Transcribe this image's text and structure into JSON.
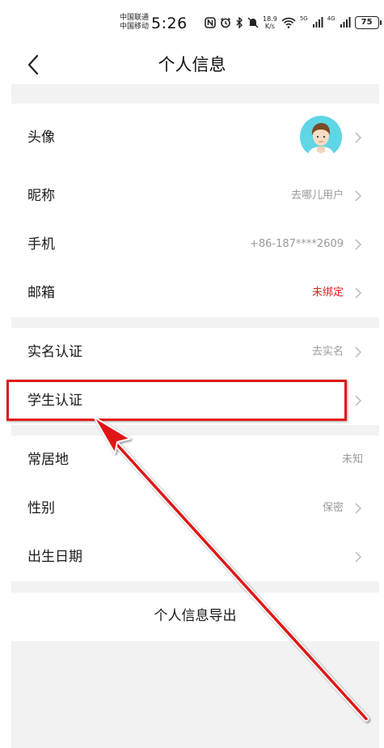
{
  "status_bar": {
    "carrier_1": "中国联通",
    "carrier_2": "中国移动",
    "time": "5:26",
    "speed_value": "18.9",
    "speed_unit": "K/s",
    "signal_1_label": "5G",
    "signal_2_label": "4G",
    "battery": "75",
    "icons": [
      "nfc-icon",
      "alarm-icon",
      "bluetooth-icon",
      "mute-icon",
      "wifi-icon",
      "signal-icon",
      "signal-icon",
      "battery-icon"
    ]
  },
  "header": {
    "title": "个人信息",
    "back_icon": "chevron-left-icon"
  },
  "profile": {
    "avatar_label": "头像",
    "nickname_label": "昵称",
    "nickname_value": "去哪儿用户",
    "phone_label": "手机",
    "phone_value": "+86-187****2609",
    "email_label": "邮箱",
    "email_value": "未绑定"
  },
  "verification": {
    "realname_label": "实名认证",
    "realname_value": "去实名",
    "student_label": "学生认证"
  },
  "details": {
    "residence_label": "常居地",
    "residence_value": "未知",
    "gender_label": "性别",
    "gender_value": "保密",
    "birthday_label": "出生日期"
  },
  "export": {
    "label": "个人信息导出"
  },
  "colors": {
    "accent_red": "#e02020",
    "annotation_red": "#e01818",
    "avatar_bg": "#5fd6e5",
    "section_gap": "#f2f2f2"
  }
}
